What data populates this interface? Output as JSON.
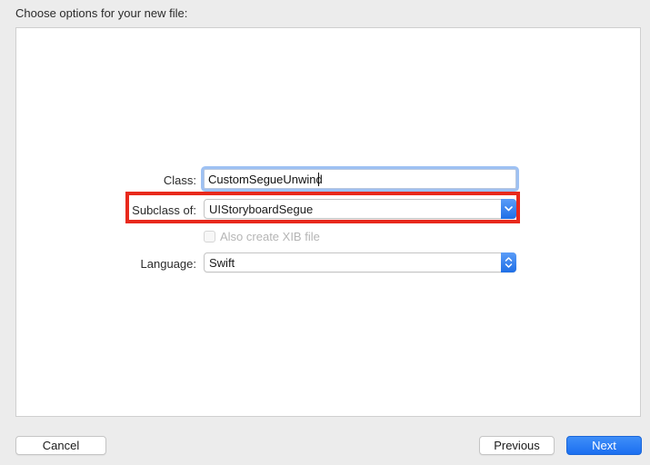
{
  "dialog": {
    "title": "Choose options for your new file:"
  },
  "form": {
    "class_label": "Class:",
    "class_value": "CustomSegueUnwind",
    "subclass_label": "Subclass of:",
    "subclass_value": "UIStoryboardSegue",
    "xib_checkbox_label": "Also create XIB file",
    "xib_checked": false,
    "language_label": "Language:",
    "language_value": "Swift"
  },
  "buttons": {
    "cancel": "Cancel",
    "previous": "Previous",
    "next": "Next"
  },
  "icons": {
    "subclass_popup": "chevron-down-icon",
    "language_popup": "chevron-up-down-icon"
  },
  "colors": {
    "accent": "#1f6fe6",
    "highlight": "#e8291c",
    "focus_ring": "#9ec1f3"
  }
}
